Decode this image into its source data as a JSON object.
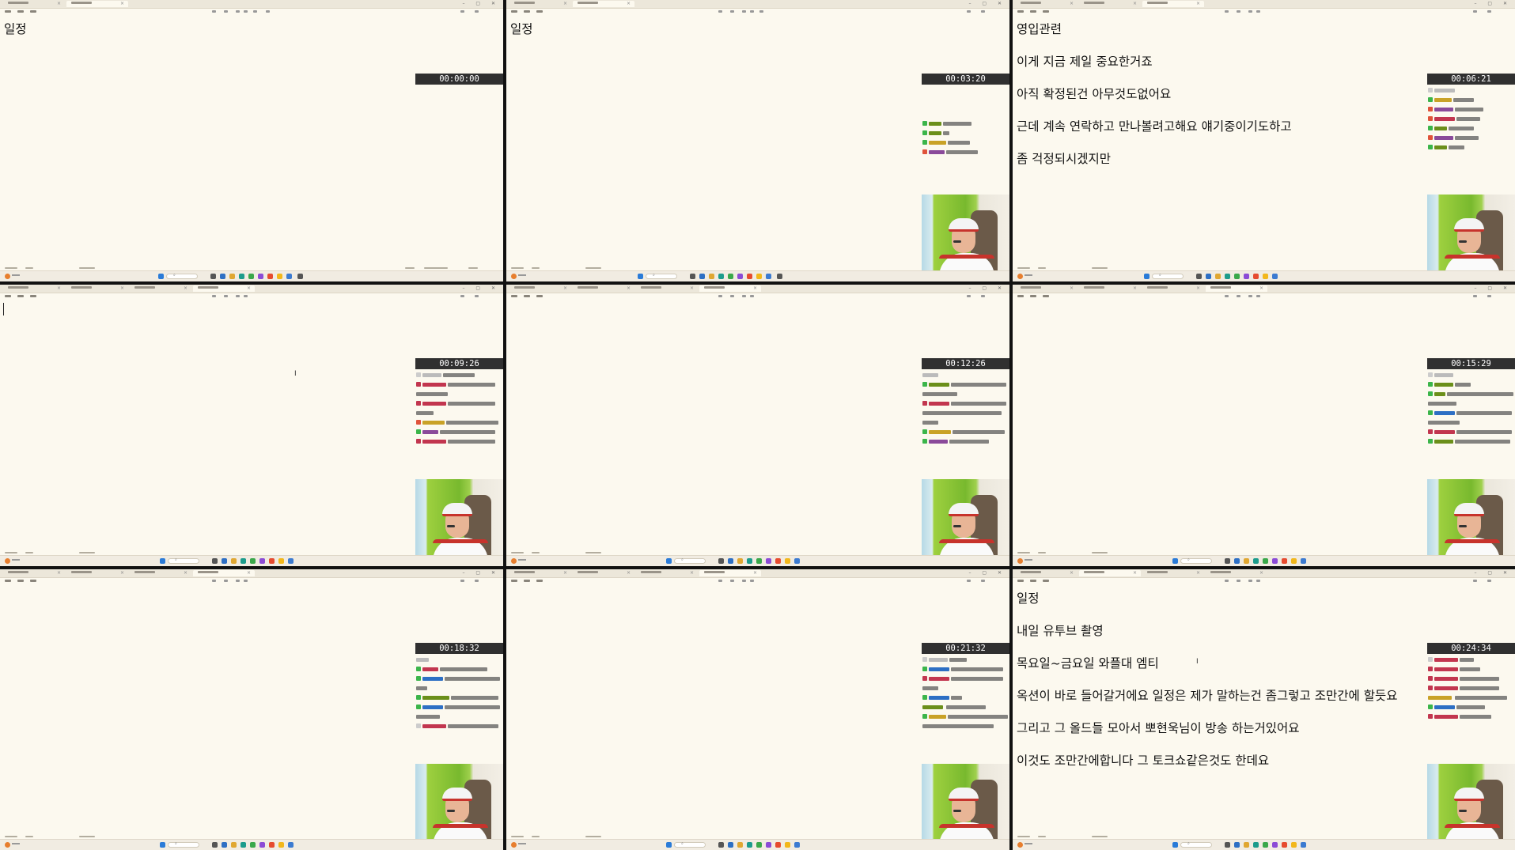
{
  "colors": {
    "page_bg": "#fcf9ef",
    "timer_bg": "#303030",
    "timer_fg": "#ffffff",
    "taskbar_bg": "#f1ece2",
    "webcam_green": "#78b92e"
  },
  "tiles": [
    {
      "doc_lines": [
        "일정"
      ],
      "timer": "00:00:00",
      "has_overlay": true,
      "chat_lines": 0,
      "has_cam": false
    },
    {
      "doc_lines": [
        "일정"
      ],
      "timer": "00:03:20",
      "has_overlay": true,
      "chat_lines": 4,
      "has_cam": true
    },
    {
      "doc_lines": [
        "영입관련",
        "이게 지금 제일 중요한거죠",
        "아직 확정된건 아무것도없어요",
        "근데 계속 연락하고 만나볼려고해요 얘기중이기도하고",
        "좀 걱정되시겠지만"
      ],
      "timer": "00:06:21",
      "has_overlay": true,
      "chat_lines": 7,
      "has_cam": true
    },
    {
      "doc_lines": [],
      "timer": "00:09:26",
      "has_overlay": true,
      "chat_lines": 8,
      "has_cam": true,
      "has_caret": true
    },
    {
      "doc_lines": [],
      "timer": "00:12:26",
      "has_overlay": true,
      "chat_lines": 8,
      "has_cam": true
    },
    {
      "doc_lines": [],
      "timer": "00:15:29",
      "has_overlay": true,
      "chat_lines": 8,
      "has_cam": true
    },
    {
      "doc_lines": [],
      "timer": "00:18:32",
      "has_overlay": true,
      "chat_lines": 8,
      "has_cam": true
    },
    {
      "doc_lines": [],
      "timer": "00:21:32",
      "has_overlay": true,
      "chat_lines": 8,
      "has_cam": true
    },
    {
      "doc_lines": [
        "일정",
        "내일 유투브 촬영",
        "목요일~금요일 와플대 엠티",
        "옥션이 바로 들어갈거에요 일정은 제가 말하는건 좀그렇고 조만간에 할듯요",
        "그리고 그 올드들 모아서 뽀현욱님이 방송 하는거있어요",
        "이것도 조만간에합니다 그 토크쇼같은것도 한데요"
      ],
      "timer": "00:24:34",
      "has_overlay": true,
      "chat_lines": 8,
      "has_cam": true
    }
  ]
}
